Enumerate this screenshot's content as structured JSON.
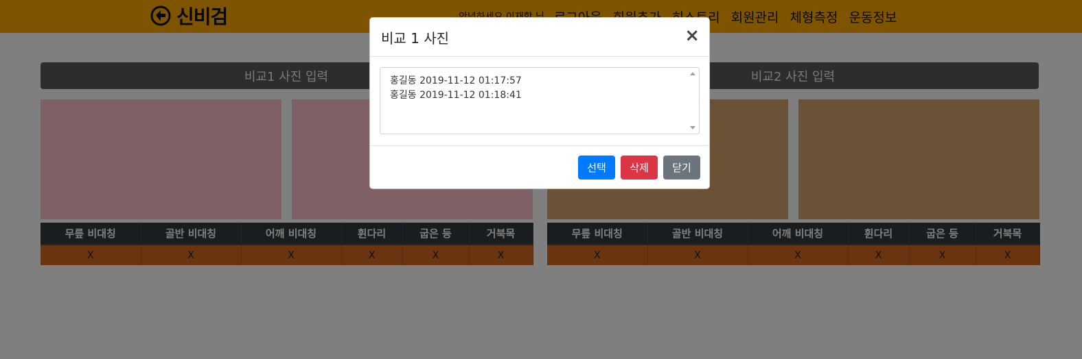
{
  "navbar": {
    "brand": "신비검",
    "greeting": "안녕하세요 이재학 님",
    "menu": [
      "로그아웃",
      "회원추가",
      "히스토리",
      "회원관리",
      "체형측정",
      "운동정보"
    ]
  },
  "sections": [
    {
      "title": "비교1 사진 입력"
    },
    {
      "title": "비교2 사진 입력"
    }
  ],
  "table": {
    "headers": [
      "무릎 비대칭",
      "골반 비대칭",
      "어깨 비대칭",
      "휜다리",
      "굽은 등",
      "거북목"
    ],
    "left_values": [
      "X",
      "X",
      "X",
      "X",
      "X",
      "X"
    ],
    "right_values": [
      "X",
      "X",
      "X",
      "X",
      "X",
      "X"
    ]
  },
  "modal": {
    "title": "비교 1 사진",
    "close_symbol": "×",
    "items": [
      "홍길동 2019-11-12 01:17:57",
      "홍길동 2019-11-12 01:18:41"
    ],
    "buttons": {
      "select": "선택",
      "delete": "삭제",
      "close": "닫기"
    }
  },
  "colors": {
    "navbar": "#ffa800",
    "primary": "#007bff",
    "danger": "#dc3545",
    "secondary": "#6c757d"
  }
}
